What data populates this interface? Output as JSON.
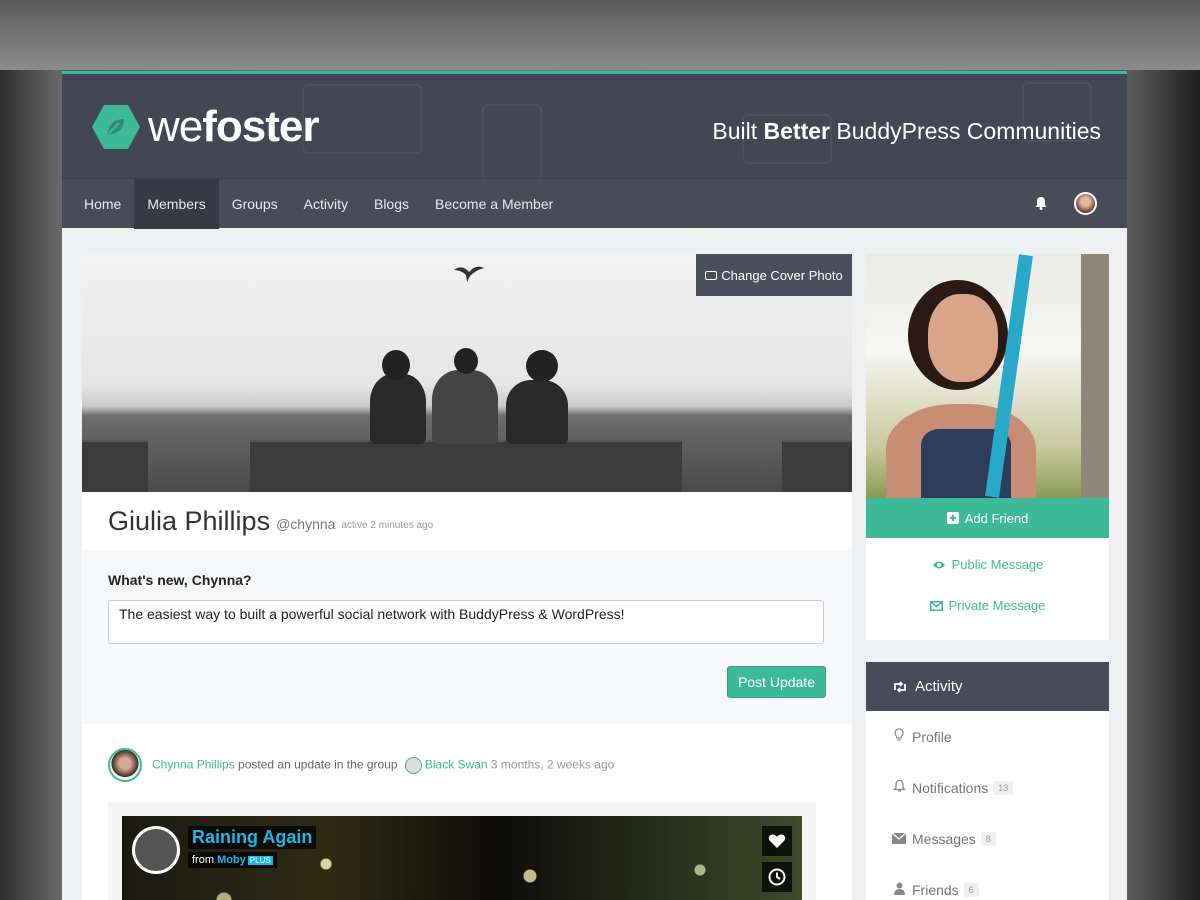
{
  "header": {
    "logo_prefix": "we",
    "logo_suffix": "foster",
    "tagline_pre": "Built ",
    "tagline_bold": "Better",
    "tagline_post": " BuddyPress Communities"
  },
  "nav": {
    "items": [
      {
        "label": "Home"
      },
      {
        "label": "Members"
      },
      {
        "label": "Groups"
      },
      {
        "label": "Activity"
      },
      {
        "label": "Blogs"
      },
      {
        "label": "Become a Member"
      }
    ],
    "active": "Members"
  },
  "cover": {
    "change_label": "Change Cover Photo"
  },
  "profile": {
    "name": "Giulia Phillips",
    "handle": "@chynna",
    "active": "active 2 minutes ago"
  },
  "whats_new": {
    "label": "What's new, Chynna?",
    "value": "The easiest way to built a powerful social network with BuddyPress & WordPress!",
    "button": "Post Update"
  },
  "activity": {
    "user": "Chynna Phillips",
    "action": " posted an update in the group ",
    "group": "Black Swan",
    "time": " 3 months, 2 weeks ago",
    "video": {
      "title": "Raining Again",
      "from": "from ",
      "author": "Moby",
      "badge": "PLUS"
    }
  },
  "sidebar": {
    "add_friend": "Add Friend",
    "public_message": "Public Message",
    "private_message": "Private Message",
    "nav": {
      "active": "Activity",
      "profile": "Profile",
      "notifications": "Notifications",
      "notifications_count": "13",
      "messages": "Messages",
      "messages_count": "8",
      "friends": "Friends",
      "friends_count": "6"
    }
  },
  "colors": {
    "accent": "#3dbb98",
    "header_bg": "#424753",
    "nav_bg": "#474c58"
  }
}
